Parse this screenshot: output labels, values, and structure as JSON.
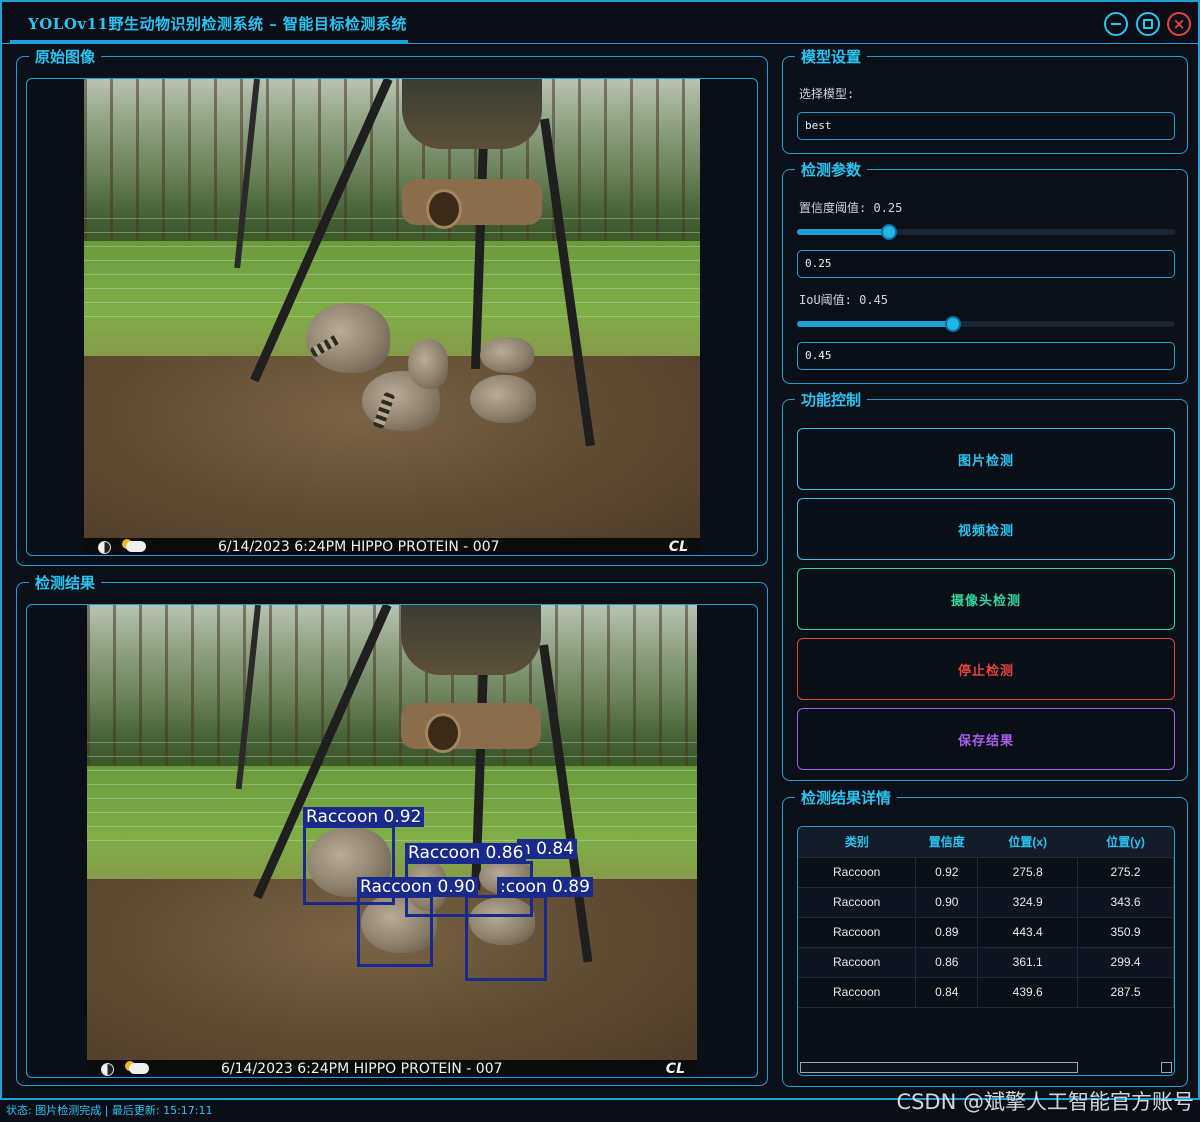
{
  "window": {
    "title": "YOLOv11野生动物识别检测系统 – 智能目标检测系统"
  },
  "panels": {
    "original_title": "原始图像",
    "result_title": "检测结果"
  },
  "camera_stamp": {
    "datetime": "6/14/2023   6:24PM   HIPPO PROTEIN - 007",
    "brand": "CL"
  },
  "detections": [
    {
      "label": "Raccoon 0.92"
    },
    {
      "label": "Raccoon 0.86"
    },
    {
      "label": "n 0.84"
    },
    {
      "label": "Raccoon 0.90"
    },
    {
      "label": ":coon 0.89"
    }
  ],
  "model": {
    "group_title": "模型设置",
    "select_label": "选择模型:",
    "selected": "best"
  },
  "params": {
    "group_title": "检测参数",
    "conf_label": "置信度阈值: 0.25",
    "conf_value": "0.25",
    "conf_fraction": 0.25,
    "iou_label": "IoU阈值: 0.45",
    "iou_value": "0.45",
    "iou_fraction": 0.45
  },
  "controls": {
    "group_title": "功能控制",
    "image_detect": "图片检测",
    "video_detect": "视频检测",
    "camera_detect": "摄像头检测",
    "stop_detect": "停止检测",
    "save_result": "保存结果",
    "colors": {
      "image_detect": "#27c4f2",
      "video_detect": "#27c4f2",
      "camera_detect": "#2fd6a0",
      "stop_detect": "#e0453f",
      "save_result": "#a95ef0"
    }
  },
  "results": {
    "group_title": "检测结果详情",
    "headers": [
      "类别",
      "置信度",
      "位置(x)",
      "位置(y)"
    ],
    "rows": [
      [
        "Raccoon",
        "0.92",
        "275.8",
        "275.2"
      ],
      [
        "Raccoon",
        "0.90",
        "324.9",
        "343.6"
      ],
      [
        "Raccoon",
        "0.89",
        "443.4",
        "350.9"
      ],
      [
        "Raccoon",
        "0.86",
        "361.1",
        "299.4"
      ],
      [
        "Raccoon",
        "0.84",
        "439.6",
        "287.5"
      ]
    ]
  },
  "status": {
    "text": "状态: 图片检测完成 | 最后更新: 15:17:11"
  },
  "watermark": "CSDN @斌擎人工智能官方账号",
  "theme": {
    "accent": "#1e9fd8",
    "text_accent": "#27c4f2",
    "box_color": "#1a2a8c"
  }
}
